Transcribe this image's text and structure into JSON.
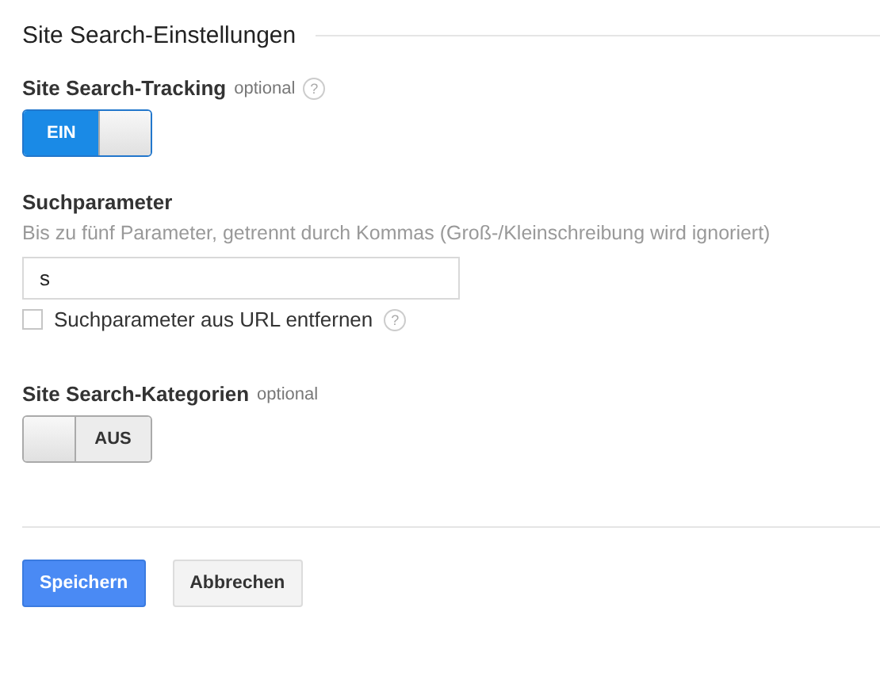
{
  "section_title": "Site Search-Einstellungen",
  "tracking": {
    "label": "Site Search-Tracking",
    "optional": "optional",
    "help": "?",
    "toggle": {
      "on": true,
      "label": "EIN"
    }
  },
  "parameter": {
    "label": "Suchparameter",
    "hint": "Bis zu fünf Parameter, getrennt durch Kommas (Groß-/Kleinschreibung wird ignoriert)",
    "value": "s",
    "checkbox": {
      "label": "Suchparameter aus URL entfernen",
      "checked": false,
      "help": "?"
    }
  },
  "categories": {
    "label": "Site Search-Kategorien",
    "optional": "optional",
    "toggle": {
      "on": false,
      "label": "AUS"
    }
  },
  "buttons": [
    {
      "label": "Speichern",
      "kind": "primary"
    },
    {
      "label": "Abbrechen",
      "kind": "secondary"
    }
  ]
}
